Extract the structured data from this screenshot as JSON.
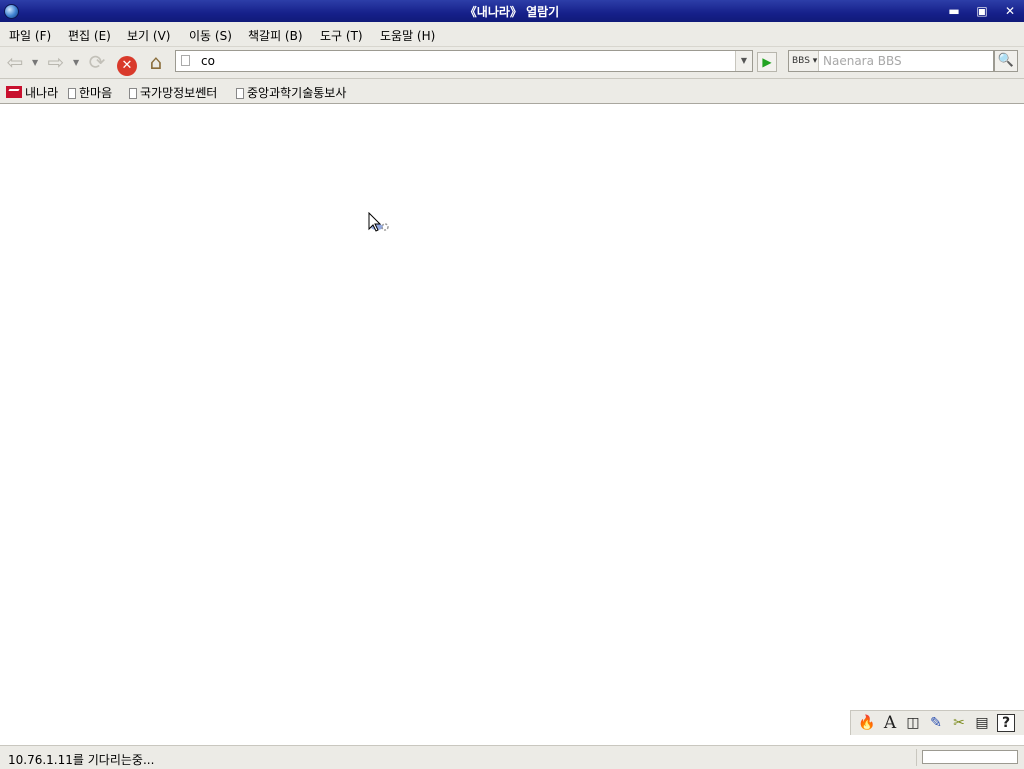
{
  "window": {
    "title": "《내나라》 열람기"
  },
  "menu": [
    {
      "label": "파일 (F)"
    },
    {
      "label": "편집 (E)"
    },
    {
      "label": "보기 (V)"
    },
    {
      "label": "이동 (S)"
    },
    {
      "label": "책갈피 (B)"
    },
    {
      "label": "도구 (T)"
    },
    {
      "label": "도움말 (H)"
    }
  ],
  "nav": {
    "url": "co",
    "search_engine": "BBS",
    "search_placeholder": "Naenara BBS"
  },
  "bookmarks": [
    {
      "label": "내나라",
      "icon": "naenara-logo"
    },
    {
      "label": "한마음",
      "icon": "page-icon"
    },
    {
      "label": "국가망정보쎈터",
      "icon": "page-icon"
    },
    {
      "label": "중앙과학기술통보사",
      "icon": "page-icon"
    }
  ],
  "addons": [
    {
      "icon": "fire-icon",
      "glyph": "🔥"
    },
    {
      "icon": "font-icon",
      "glyph": "A"
    },
    {
      "icon": "split-view-icon",
      "glyph": "◫"
    },
    {
      "icon": "edit-page-icon",
      "glyph": "✎"
    },
    {
      "icon": "tools-icon",
      "glyph": "✂"
    },
    {
      "icon": "clipboard-icon",
      "glyph": "▤"
    },
    {
      "icon": "help-icon",
      "glyph": "?"
    }
  ],
  "status": {
    "text": "10.76.1.11를 기다리는중..."
  }
}
